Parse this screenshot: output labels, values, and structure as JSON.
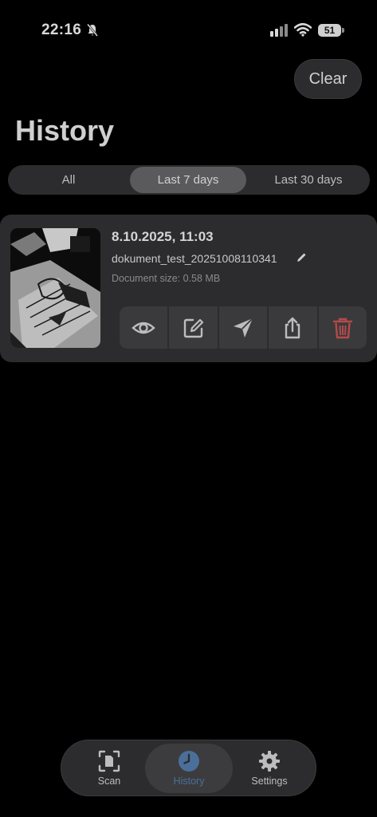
{
  "status_bar": {
    "time": "22:16",
    "battery": "51"
  },
  "header": {
    "clear_label": "Clear",
    "title": "History"
  },
  "filters": {
    "all": "All",
    "last7": "Last 7 days",
    "last30": "Last 30 days",
    "selected": "last7"
  },
  "history": [
    {
      "date": "8.10.2025, 11:03",
      "filename": "dokument_test_20251008110341",
      "size": "Document size: 0.58 MB"
    }
  ],
  "actions": [
    "eye-icon",
    "edit-icon",
    "send-icon",
    "share-icon",
    "trash-icon"
  ],
  "tabbar": {
    "scan": "Scan",
    "history": "History",
    "settings": "Settings",
    "active": "history"
  },
  "colors": {
    "background": "#000000",
    "surface": "#2c2c2e",
    "accent": "#4a6f9a",
    "danger": "#b54a4a"
  }
}
